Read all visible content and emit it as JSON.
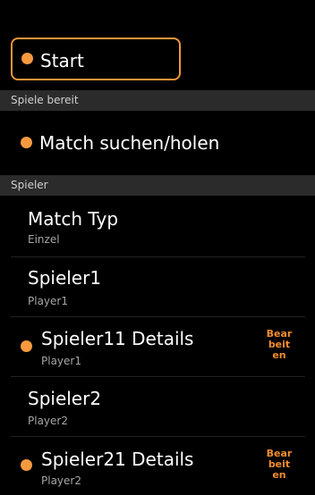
{
  "start": {
    "label": "Start"
  },
  "sections": {
    "ready": "Spiele bereit",
    "players": "Spieler"
  },
  "ready_item": {
    "label": "Match suchen/holen"
  },
  "match_type": {
    "title": "Match Typ",
    "value": "Einzel"
  },
  "player1": {
    "title": "Spieler1",
    "value": "Player1"
  },
  "player11": {
    "title": "Spieler11 Details",
    "value": "Player1",
    "action": [
      "Bear",
      "beit",
      "en"
    ]
  },
  "player2": {
    "title": "Spieler2",
    "value": "Player2"
  },
  "player21": {
    "title": "Spieler21 Details",
    "value": "Player2",
    "action": [
      "Bear",
      "beit",
      "en"
    ]
  },
  "colors": {
    "accent": "#f79a3f",
    "edit_text": "#f08d2e",
    "section_bg": "#2b2b2b",
    "background": "#000000"
  }
}
